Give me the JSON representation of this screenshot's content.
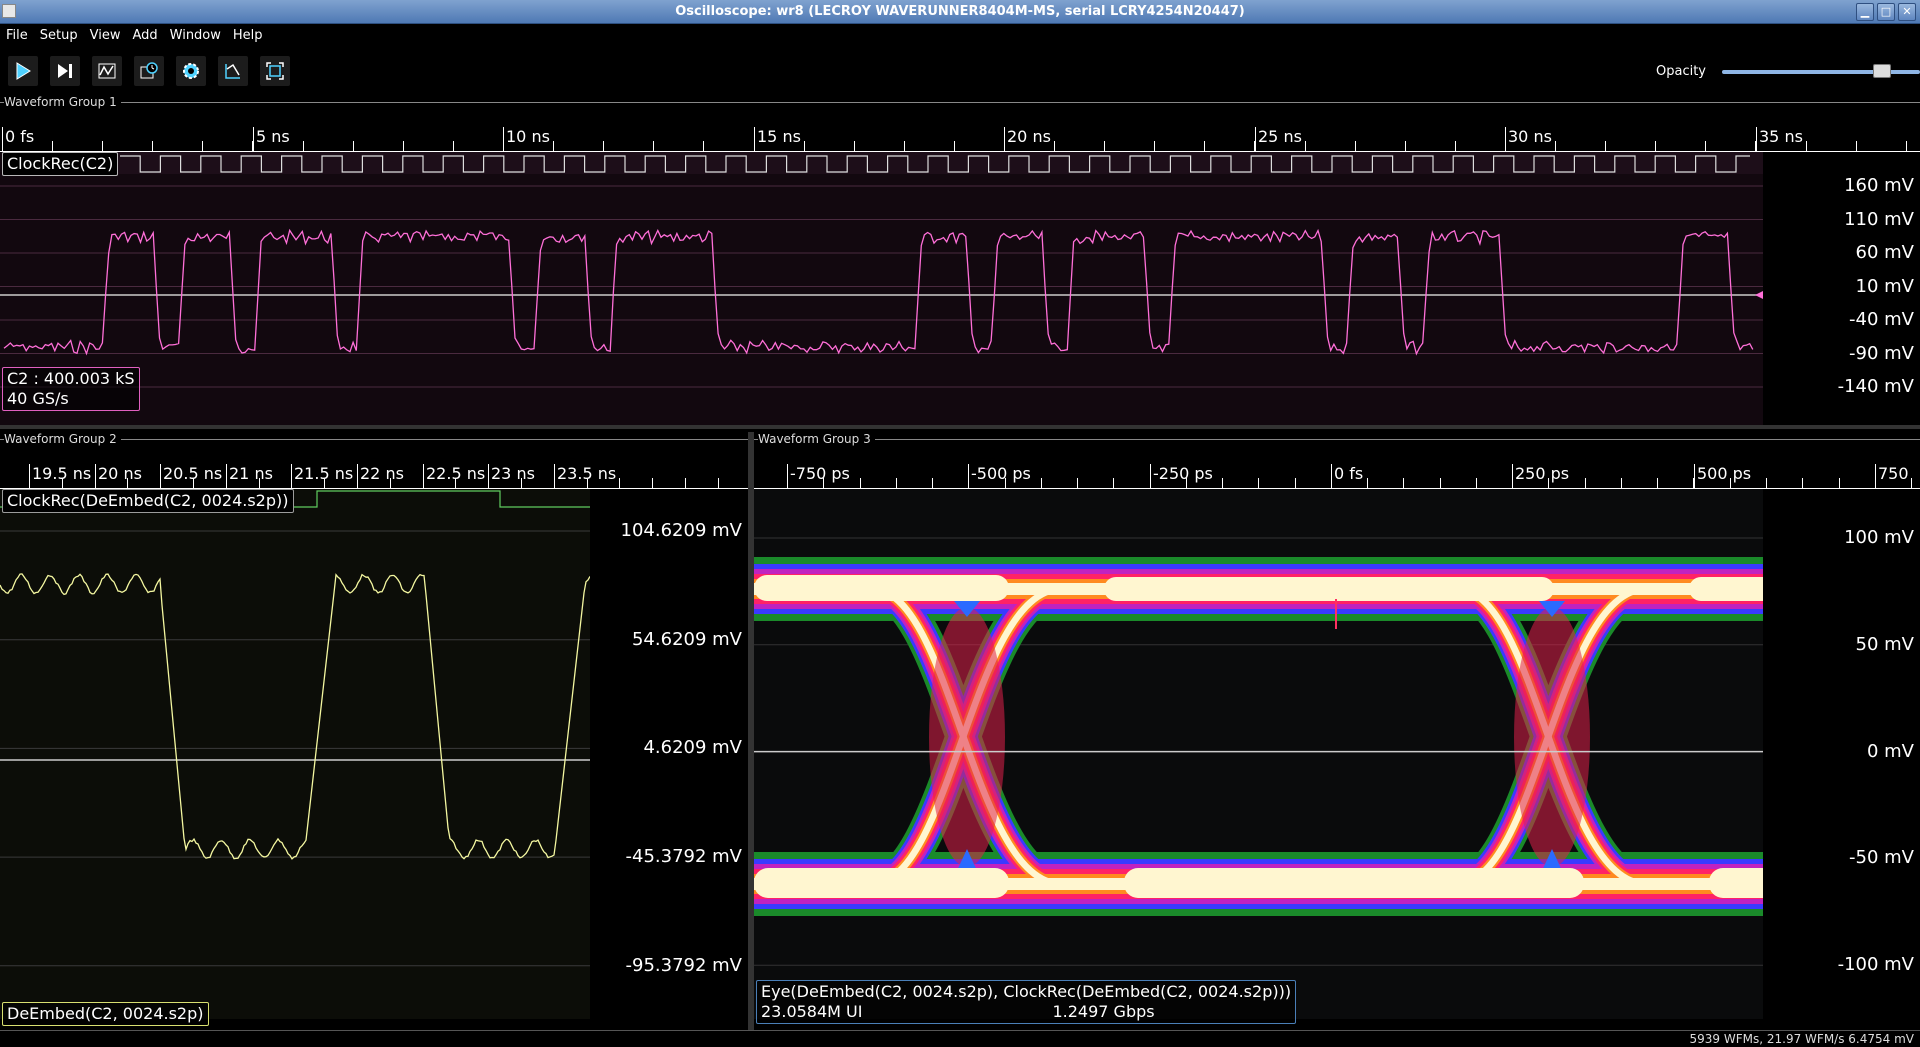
{
  "window": {
    "title": "Oscilloscope: wr8 (LECROY WAVERUNNER8404M-MS, serial LCRY4254N20447)"
  },
  "menu": [
    "File",
    "Setup",
    "View",
    "Add",
    "Window",
    "Help"
  ],
  "toolbar": {
    "buttons": [
      "start-trigger",
      "single-trigger",
      "waveform",
      "add-measurement",
      "settings",
      "cursor",
      "fullscreen"
    ],
    "opacity_label": "Opacity",
    "opacity_value": 0.85
  },
  "groups": [
    {
      "label": "Waveform Group 1",
      "time_ticks": [
        "0 fs",
        "5 ns",
        "10 ns",
        "15 ns",
        "20 ns",
        "25 ns",
        "30 ns",
        "35 ns"
      ],
      "y_ticks": [
        "160 mV",
        "110 mV",
        "60 mV",
        "10 mV",
        "-40 mV",
        "-90 mV",
        "-140 mV"
      ],
      "clock_label": "ClockRec(C2)",
      "channel_info": [
        "C2 : 400.003 kS",
        "40 GS/s"
      ],
      "trace_color": "#ff6fd8",
      "bits": [
        0,
        0,
        0,
        0,
        1,
        1,
        0,
        1,
        1,
        0,
        1,
        1,
        1,
        0,
        1,
        1,
        1,
        1,
        1,
        1,
        0,
        1,
        1,
        0,
        1,
        1,
        1,
        1,
        0,
        0,
        0,
        0,
        0,
        0,
        0,
        0,
        1,
        1,
        0,
        1,
        1,
        0,
        1,
        1,
        1,
        0,
        1,
        1,
        1,
        1,
        1,
        1,
        0,
        1,
        1,
        0,
        1,
        1,
        1,
        0,
        0,
        0,
        0,
        0,
        0,
        0,
        1,
        1,
        0
      ]
    },
    {
      "label": "Waveform Group 2",
      "time_ticks": [
        "19.5 ns",
        "20 ns",
        "20.5 ns",
        "21 ns",
        "21.5 ns",
        "22 ns",
        "22.5 ns",
        "23 ns",
        "23.5 ns"
      ],
      "y_ticks": [
        "104.6209 mV",
        "54.6209 mV",
        "4.6209 mV",
        "-45.3792 mV",
        "-95.3792 mV"
      ],
      "clock_label": "ClockRec(DeEmbed(C2, 0024.s2p))",
      "channel_info": [
        "DeEmbed(C2, 0024.s2p)"
      ],
      "trace_color": "#f4f7a0"
    },
    {
      "label": "Waveform Group 3",
      "time_ticks": [
        "-750 ps",
        "-500 ps",
        "-250 ps",
        "0 fs",
        "250 ps",
        "500 ps",
        "750"
      ],
      "y_ticks": [
        "100 mV",
        "50 mV",
        "0 mV",
        "-50 mV",
        "-100 mV"
      ],
      "eye_info": [
        "Eye(DeEmbed(C2, 0024.s2p), ClockRec(DeEmbed(C2, 0024.s2p)))",
        "23.0584M UI",
        "1.2497 Gbps"
      ]
    }
  ],
  "status": "5939 WFMs, 21.97 WFM/s 6.4754 mV"
}
